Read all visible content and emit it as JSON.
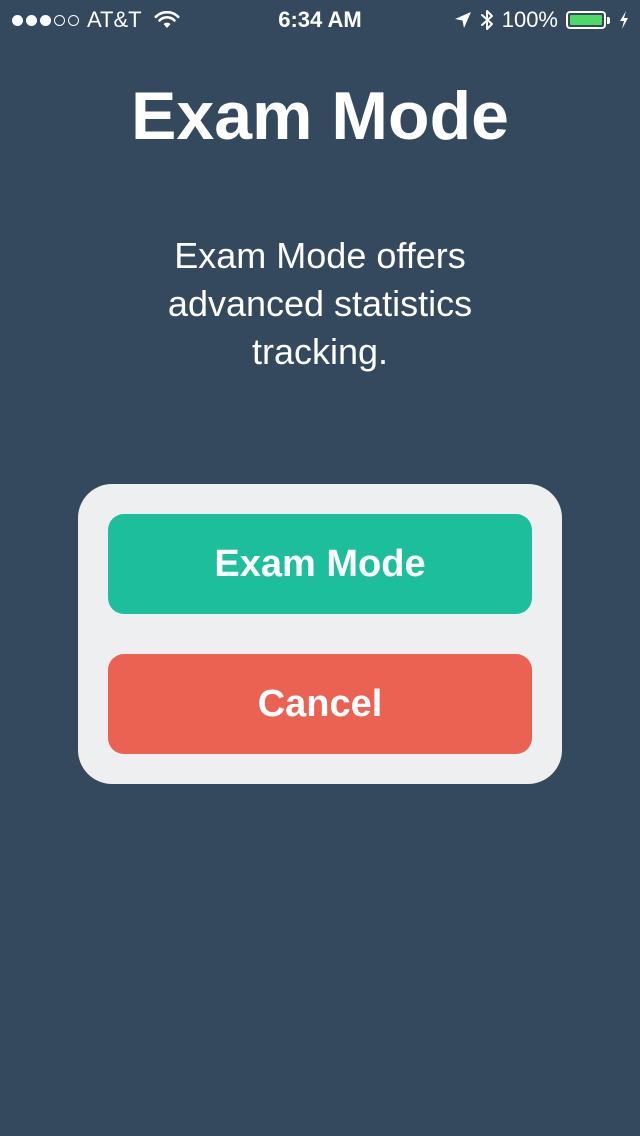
{
  "status_bar": {
    "signal_dots": [
      true,
      true,
      true,
      false,
      false
    ],
    "carrier": "AT&T",
    "time": "6:34 AM",
    "battery_percent": "100%",
    "battery_level": 1.0,
    "icons": [
      "wifi-icon",
      "location-arrow-icon",
      "bluetooth-icon",
      "battery-icon",
      "charging-bolt-icon"
    ]
  },
  "title": "Exam Mode",
  "description": "Exam Mode offers advanced statistics tracking.",
  "dialog": {
    "primary_label": "Exam Mode",
    "cancel_label": "Cancel"
  },
  "colors": {
    "background": "#35495e",
    "dialog_bg": "#eeeff1",
    "primary": "#1dbe9b",
    "cancel": "#eb6253",
    "battery": "#4cd964"
  }
}
